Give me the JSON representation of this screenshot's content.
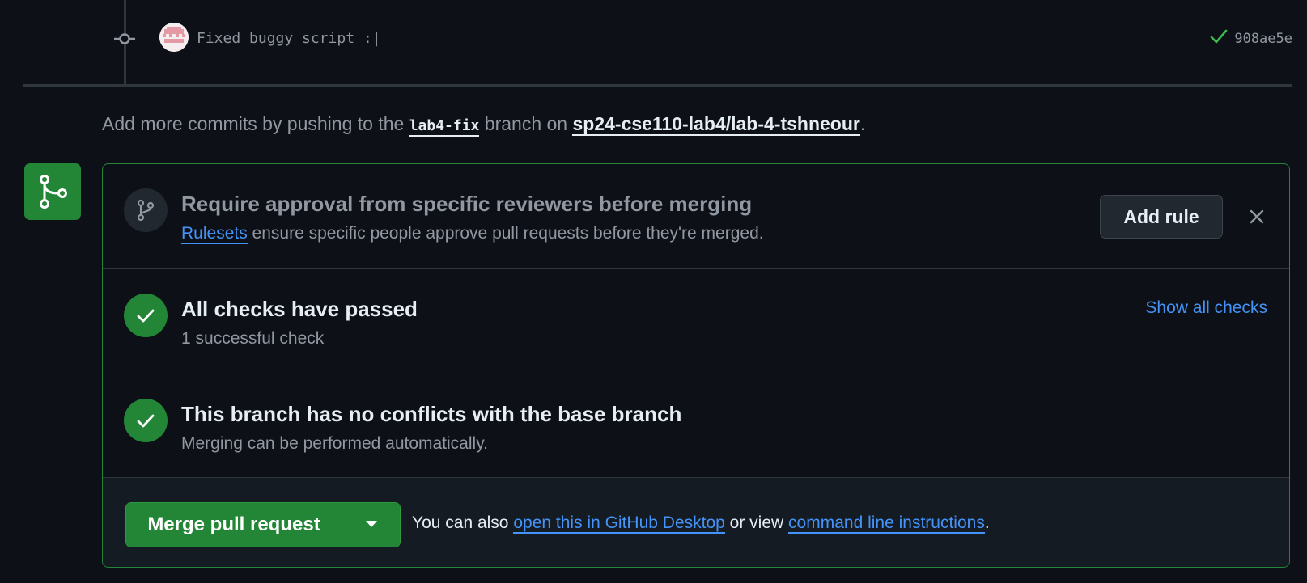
{
  "commit": {
    "message": "Fixed buggy script :|",
    "sha": "908ae5e",
    "status": "success"
  },
  "push_note": {
    "prefix": "Add more commits by pushing to the",
    "branch": "lab4-fix",
    "middle": "branch on",
    "repo": "sp24-cse110-lab4/lab-4-tshneour",
    "suffix": "."
  },
  "rule_prompt": {
    "title": "Require approval from specific reviewers before merging",
    "link": "Rulesets",
    "description": "ensure specific people approve pull requests before they're merged.",
    "add_rule_label": "Add rule"
  },
  "checks": {
    "title": "All checks have passed",
    "subtitle": "1 successful check",
    "show_all_label": "Show all checks"
  },
  "conflicts": {
    "title": "This branch has no conflicts with the base branch",
    "subtitle": "Merging can be performed automatically."
  },
  "merge": {
    "button_label": "Merge pull request",
    "note_prefix": "You can also",
    "desktop_link": "open this in GitHub Desktop",
    "note_middle": "or view",
    "cli_link": "command line instructions",
    "note_suffix": "."
  },
  "colors": {
    "background": "#0d1117",
    "success_green": "#238636",
    "link_blue": "#4493f8",
    "muted_text": "#9198a1",
    "border": "#30363d"
  }
}
